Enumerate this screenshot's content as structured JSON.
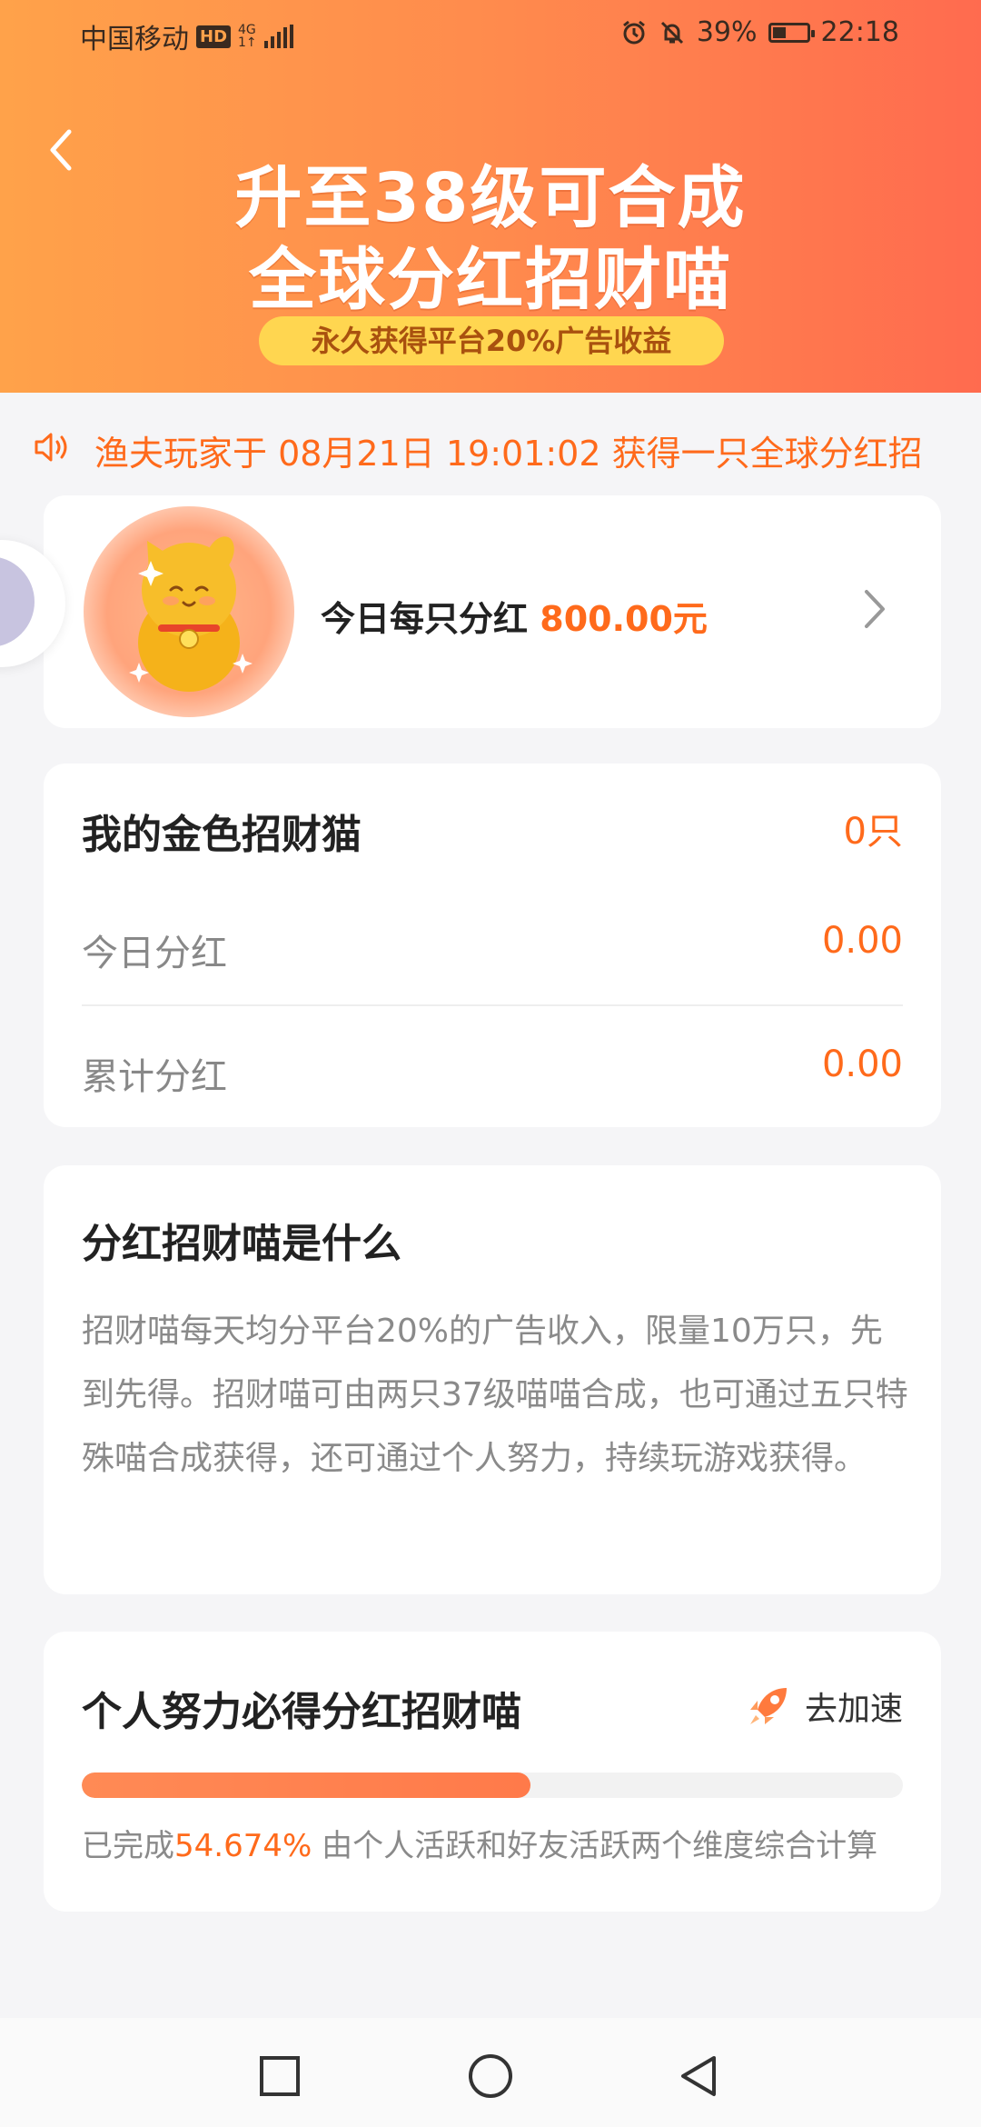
{
  "status": {
    "carrier": "中国移动",
    "hd": "HD",
    "net_top": "4G",
    "net_bottom": "1↑",
    "battery": "39%",
    "time": "22:18"
  },
  "header": {
    "title_line1": "升至38级可合成",
    "title_line2": "全球分红招财喵",
    "pill": "永久获得平台20%广告收益"
  },
  "marquee": {
    "text": "渔夫玩家于 08月21日 19:01:02 获得一只全球分红招"
  },
  "dividend": {
    "label": "今日每只分红",
    "amount": "800.00元"
  },
  "my_cats": {
    "title": "我的金色招财猫",
    "count": "0只",
    "today_label": "今日分红",
    "today_value": "0.00",
    "total_label": "累计分红",
    "total_value": "0.00"
  },
  "about": {
    "title": "分红招财喵是什么",
    "body": "招财喵每天均分平台20%的广告收入，限量10万只，先到先得。招财喵可由两只37级喵喵合成，也可通过五只特殊喵合成获得，还可通过个人努力，持续玩游戏获得。"
  },
  "effort": {
    "title": "个人努力必得分红招财喵",
    "speed_label": "去加速",
    "progress": 0.54674,
    "note_prefix": "已完成",
    "percent": "54.674%",
    "note_suffix": " 由个人活跃和好友活跃两个维度综合计算"
  },
  "colors": {
    "accent": "#ff6a1b",
    "header_start": "#ffa24a",
    "header_end": "#ff6b4f",
    "pill_bg": "#ffd650"
  }
}
